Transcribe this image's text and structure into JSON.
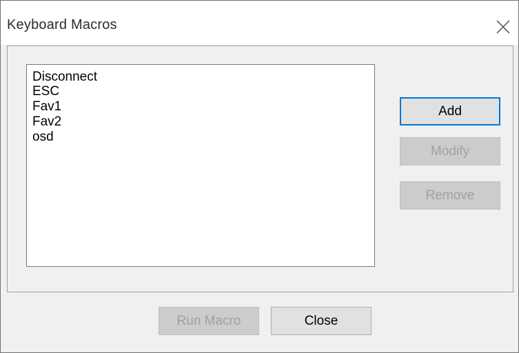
{
  "window": {
    "title": "Keyboard Macros",
    "close_icon": "close-icon"
  },
  "macros": {
    "items": [
      "Disconnect",
      "ESC",
      "Fav1",
      "Fav2",
      "osd"
    ]
  },
  "buttons": {
    "add": "Add",
    "modify": "Modify",
    "remove": "Remove",
    "run_macro": "Run Macro",
    "close": "Close"
  },
  "colors": {
    "focus_border": "#0078d7",
    "dialog_bg": "#f0f0f0",
    "button_bg": "#e1e1e1",
    "disabled_text": "#a0a0a0"
  }
}
